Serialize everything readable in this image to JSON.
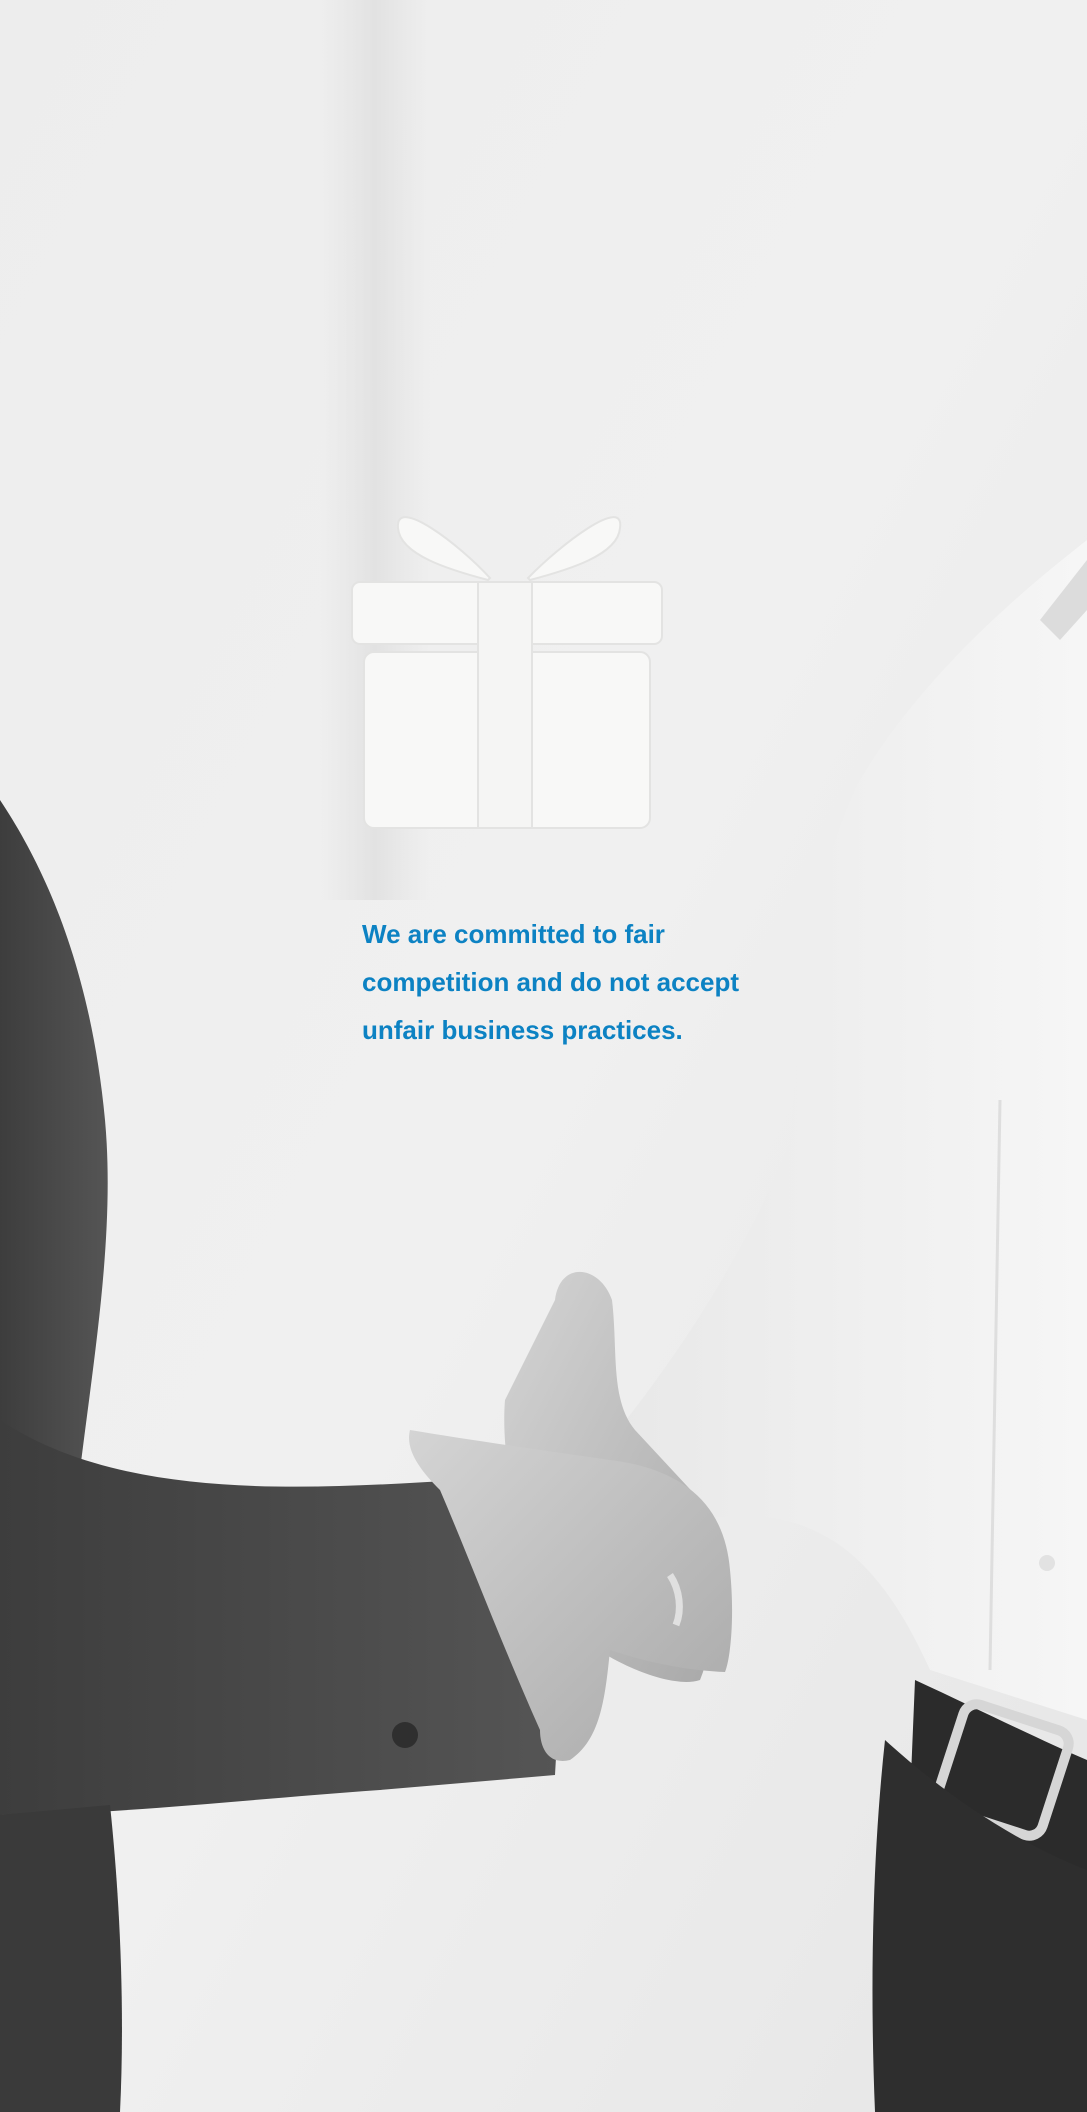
{
  "message": {
    "lines": [
      "We are committed to fair",
      "competition and do not accept",
      "unfair business practices."
    ]
  },
  "icon": "gift-icon",
  "colors": {
    "background": "#ececec",
    "accent_text": "#0c82c3",
    "icon_fill": "#f8f8f7",
    "dark_sleeve": "#4a4a4a",
    "shirt": "#f3f3f3",
    "skin": "#c4c4c4"
  }
}
